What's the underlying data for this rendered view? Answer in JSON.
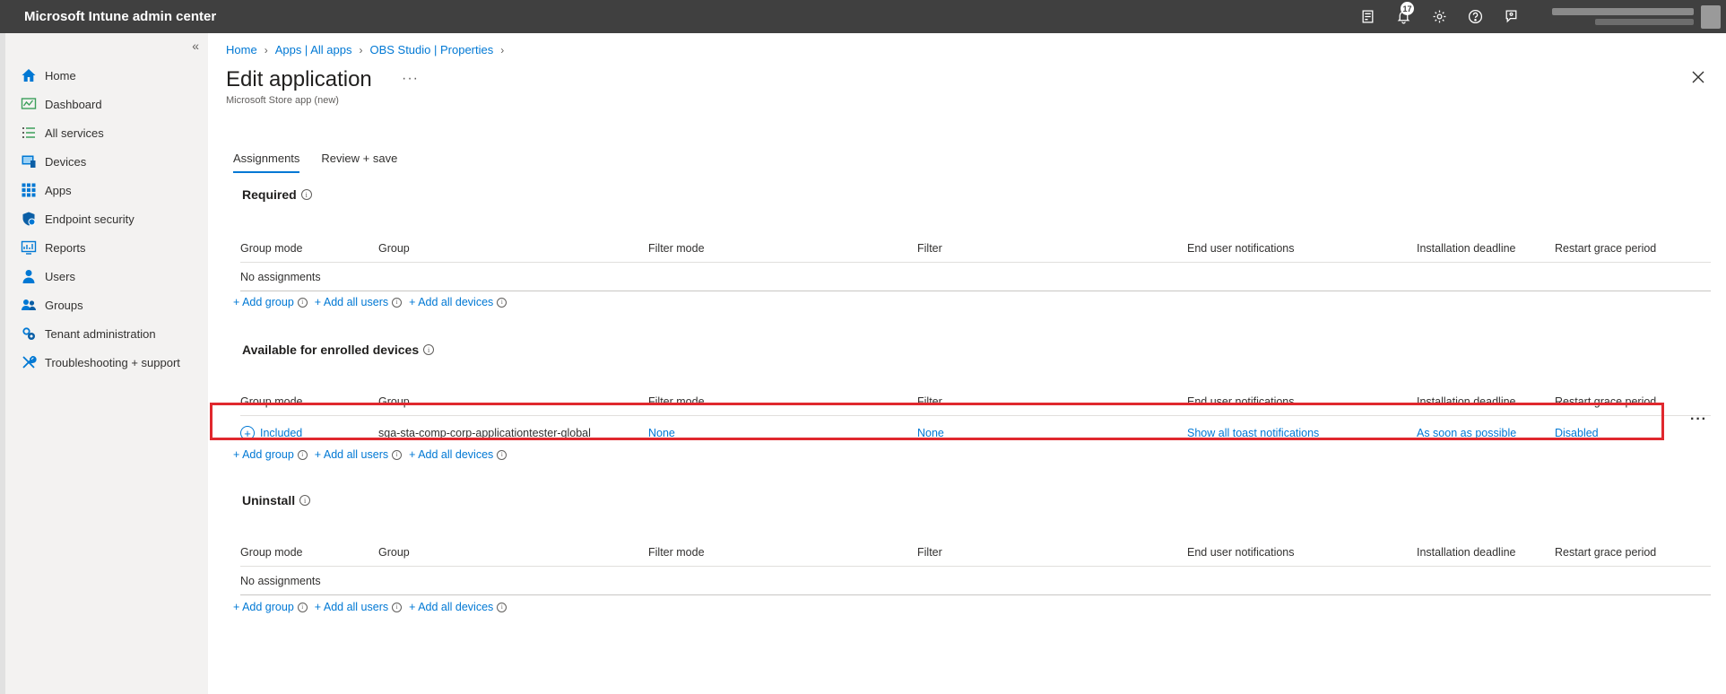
{
  "topbar": {
    "title": "Microsoft Intune admin center",
    "notification_count": "17",
    "icons": [
      "portal-feedback-icon",
      "bell-icon",
      "gear-icon",
      "help-icon",
      "feedback-icon"
    ]
  },
  "sidebar": {
    "collapse_glyph": "«",
    "items": [
      {
        "label": "Home",
        "icon": "home-icon"
      },
      {
        "label": "Dashboard",
        "icon": "dashboard-icon"
      },
      {
        "label": "All services",
        "icon": "list-icon"
      },
      {
        "label": "Devices",
        "icon": "devices-icon"
      },
      {
        "label": "Apps",
        "icon": "apps-grid-icon"
      },
      {
        "label": "Endpoint security",
        "icon": "shield-icon"
      },
      {
        "label": "Reports",
        "icon": "reports-icon"
      },
      {
        "label": "Users",
        "icon": "user-icon"
      },
      {
        "label": "Groups",
        "icon": "groups-icon"
      },
      {
        "label": "Tenant administration",
        "icon": "tenant-admin-icon"
      },
      {
        "label": "Troubleshooting + support",
        "icon": "wrench-icon"
      }
    ]
  },
  "breadcrumb": [
    "Home",
    "Apps | All apps",
    "OBS Studio | Properties"
  ],
  "page": {
    "title": "Edit application",
    "more": "···",
    "subtitle": "Microsoft Store app (new)"
  },
  "tabs": [
    "Assignments",
    "Review + save"
  ],
  "columns": [
    "Group mode",
    "Group",
    "Filter mode",
    "Filter",
    "End user notifications",
    "Installation deadline",
    "Restart grace period"
  ],
  "sections": {
    "required": {
      "title": "Required",
      "empty_text": "No assignments"
    },
    "available": {
      "title": "Available for enrolled devices",
      "row": {
        "group_mode": "Included",
        "group": "sga-sta-comp-corp-applicationtester-global",
        "filter_mode": "None",
        "filter": "None",
        "notifications": "Show all toast notifications",
        "deadline": "As soon as possible",
        "restart": "Disabled",
        "more": "···"
      }
    },
    "uninstall": {
      "title": "Uninstall",
      "empty_text": "No assignments"
    }
  },
  "adders": {
    "add_group": "+ Add group",
    "add_users": "+ Add all users",
    "add_devices": "+ Add all devices"
  },
  "colors": {
    "accent": "#0078d4",
    "topbar": "#404040",
    "highlight": "#e0282e"
  }
}
